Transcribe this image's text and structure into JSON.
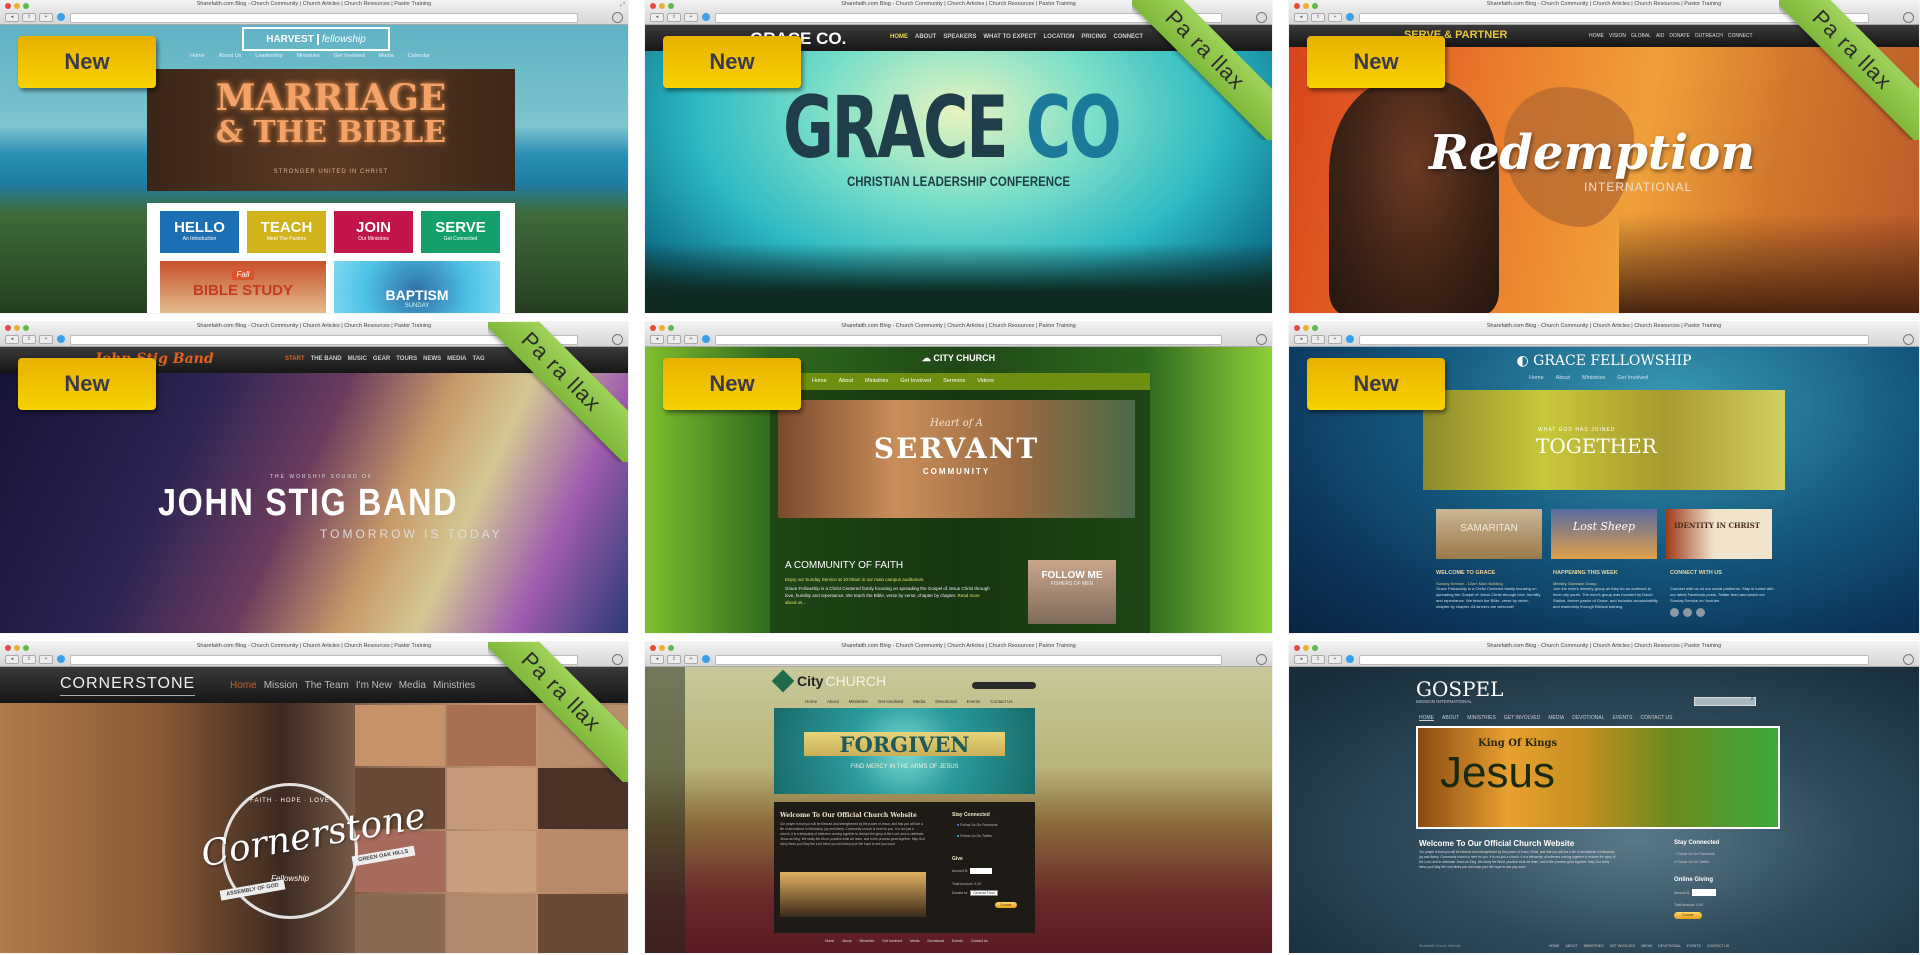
{
  "browser": {
    "window_title": "Sharefaith.com Blog - Church Community | Church Articles | Church Resources | Pastor Training",
    "traffic_lights": [
      "#e24b41",
      "#e8b42c",
      "#5dbb47"
    ]
  },
  "badges": {
    "new_label": "New",
    "parallax_label": "Pa ra llax",
    "new_color": "#f2c300",
    "parallax_color": "#8cc34a"
  },
  "tiles": [
    {
      "name": "Harvest Fellowship",
      "new": true,
      "parallax": false,
      "logo": "HARVEST",
      "logo_script": "fellowship",
      "nav": [
        "Home",
        "About Us",
        "Leadership",
        "Ministries",
        "Get Involved",
        "Media",
        "Calendar"
      ],
      "hero_title_1": "MARRIAGE",
      "hero_title_2": "& THE BIBLE",
      "hero_subtitle": "STRONGER UNITED IN CHRIST",
      "boxes": [
        {
          "title": "HELLO",
          "sub": "An Introduction",
          "color": "#1d6fb3"
        },
        {
          "title": "TEACH",
          "sub": "Meet The Pastors",
          "color": "#c9b01d"
        },
        {
          "title": "JOIN",
          "sub": "Our Ministries",
          "color": "#c2154a"
        },
        {
          "title": "SERVE",
          "sub": "Get Connected",
          "color": "#13a06a"
        }
      ],
      "promo_1_tag": "Fall",
      "promo_1": "BIBLE STUDY",
      "promo_2": "BAPTISM",
      "promo_2_sub": "SUNDAY"
    },
    {
      "name": "Grace Co.",
      "new": true,
      "parallax": true,
      "logo": "GRACE CO.",
      "nav": [
        "HOME",
        "ABOUT",
        "SPEAKERS",
        "WHAT TO EXPECT",
        "LOCATION",
        "PRICING",
        "CONNECT"
      ],
      "active_nav": "HOME",
      "hero_title_1": "GRACE",
      "hero_title_2": "CO",
      "hero_subtitle": "CHRISTIAN LEADERSHIP CONFERENCE"
    },
    {
      "name": "Redemption International",
      "new": true,
      "parallax": true,
      "logo": "SERVE & PARTNER",
      "nav": [
        "HOME",
        "VISION",
        "GLOBAL",
        "AID",
        "DONATE",
        "OUTREACH",
        "CONNECT"
      ],
      "hero_title": "Redemption",
      "hero_subtitle": "INTERNATIONAL"
    },
    {
      "name": "John Stig Band",
      "new": true,
      "parallax": true,
      "logo": "John Stig Band",
      "nav": [
        "START",
        "THE BAND",
        "MUSIC",
        "GEAR",
        "TOURS",
        "NEWS",
        "MEDIA",
        "TAG"
      ],
      "active_nav": "START",
      "hero_kicker": "THE WORSHIP SOUND OF",
      "hero_title": "JOHN STIG BAND",
      "hero_subtitle": "TOMORROW IS TODAY"
    },
    {
      "name": "City Church (green)",
      "new": true,
      "parallax": false,
      "logo": "CITY CHURCH",
      "nav": [
        "Home",
        "About",
        "Ministries",
        "Get Involved",
        "Sermons",
        "Videos"
      ],
      "hero_kicker": "Heart of A",
      "hero_title": "SERVANT",
      "hero_subtitle": "COMMUNITY",
      "section_title": "A COMMUNITY OF FAITH",
      "section_lead": "Enjoy our Sunday Service at 10:00am in our main campus auditorium.",
      "section_body": "Grace Fellowship is a Christ Centered family focusing on spreading the Gospel of Jesus Christ through love, humility and repentance. We teach the Bible, verse by verse, chapter by chapter.",
      "read_more": "Read more about us...",
      "promo": "FOLLOW ME",
      "promo_sub": "FISHERS OF MEN"
    },
    {
      "name": "Grace Fellowship",
      "new": true,
      "parallax": false,
      "logo": "GRACE FELLOWSHIP",
      "nav": [
        "Home",
        "About",
        "Ministries",
        "Get Involved"
      ],
      "hero_kicker": "WHAT GOD HAS JOINED",
      "hero_title": "TOGETHER",
      "cards": [
        "SAMARITAN",
        "Lost Sheep",
        "IDENTITY IN CHRIST"
      ],
      "columns": [
        {
          "title": "WELCOME TO GRACE",
          "lead": "Sunday Service - 10am Main Building",
          "body": "Grace Fellowship is a Christ Centered family focusing on spreading the Gospel of Jesus Christ through love, humility and repentance. We teach the Bible, verse by verse, chapter by chapter. All sinners are welcome!"
        },
        {
          "title": "HAPPENING THIS WEEK",
          "lead": "Ministry Outreach Group",
          "body": "Join the men's ministry group as they do an outreach to inner city youth. The men's group was founded by David Stallon, former pastor of Grace, and includes accountability and leadership through Biblical training."
        },
        {
          "title": "CONNECT WITH US",
          "lead": "",
          "body": "Connect with us on our social platforms. Stay in tuned with our latest Facebook posts, Twitter feed and watch our Sunday Service on Youtube."
        }
      ]
    },
    {
      "name": "Cornerstone",
      "new": false,
      "parallax": true,
      "logo": "CORNERSTONE",
      "nav": [
        "Home",
        "Mission",
        "The Team",
        "I'm New",
        "Media",
        "Ministries"
      ],
      "active_nav": "Home",
      "seal_top": "FAITH · HOPE · LOVE",
      "seal_title": "Cornerstone",
      "seal_left": "ASSEMBLY OF GOD",
      "seal_right": "GREEN OAK HILLS",
      "seal_bottom": "Fellowship"
    },
    {
      "name": "City Church (forgiven)",
      "new": false,
      "parallax": false,
      "logo_1": "City",
      "logo_2": "CHURCH",
      "nav": [
        "Home",
        "About",
        "Ministries",
        "Get Involved",
        "Media",
        "Devotional",
        "Events",
        "Contact Us"
      ],
      "hero_title": "FORGIVEN",
      "hero_subtitle": "FIND MERCY IN THE ARMS OF JESUS",
      "welcome_title": "Welcome To Our Official Church Website",
      "welcome_body": "Our prayer is that you will be blessed and strengthened by the power of Jesus, and that you will live a life of abundance in fellowship, joy and liberty. Community church is here for you. It is not just a church, it is a fellowship of believers coming together to declare the glory of the Lord, and to celebrate Jesus as King. We study the Word, practice what we learn, and in the process grow together. May God richly bless you! May the Lord bless you and keep you! We hope to see you soon!",
      "stay_connected": "Stay Connected",
      "social": [
        "Follow Us On Facebook",
        "Follow Us On Twitter"
      ],
      "give_title": "Give",
      "amount_label": "Amount $:",
      "total_label": "Total Amount:",
      "total_value": "0.00",
      "donate_to_label": "Donate to:",
      "donate_to_value": "General Fund",
      "donate_button": "Donate",
      "footer_nav": [
        "Home",
        "About",
        "Ministries",
        "Get Involved",
        "Media",
        "Devotional",
        "Events",
        "Contact Us"
      ]
    },
    {
      "name": "Gospel Mission International",
      "new": false,
      "parallax": false,
      "logo": "GOSPEL",
      "logo_sub": "MISSION INTERNATIONAL",
      "search_placeholder": "",
      "nav": [
        "HOME",
        "ABOUT",
        "MINISTRIES",
        "GET INVOLVED",
        "MEDIA",
        "DEVOTIONAL",
        "EVENTS",
        "CONTACT US"
      ],
      "hero_kicker": "King Of Kings",
      "hero_title": "Jesus",
      "welcome_title": "Welcome To Our Official Church Website",
      "welcome_body": "Our prayer is that you will be blessed and strengthened by the power of Jesus Christ, and that you will live a life of abundance in fellowship, joy and liberty. Community church is here for you. It is not just a church, it is a fellowship of believers coming together to declare the glory of the Lord, and to celebrate Jesus as King. We study the Word, practice what we learn, and in the process grow together. May God richly bless you! May the Lord bless you and keep you! We hope to see you soon!",
      "stay_connected": "Stay Connected",
      "social": [
        "Follow Us On Facebook",
        "Follow Us On Twitter"
      ],
      "give_title": "Online Giving",
      "amount_label": "Amount $:",
      "total_label": "Total Amount:",
      "total_value": "0.00",
      "donate_button": "Donate",
      "footer_left": "Sharefaith Church Website",
      "footer_nav": [
        "HOME",
        "ABOUT",
        "MINISTRIES",
        "GET INVOLVED",
        "MEDIA",
        "DEVOTIONAL",
        "EVENTS",
        "CONTACT US"
      ]
    }
  ]
}
